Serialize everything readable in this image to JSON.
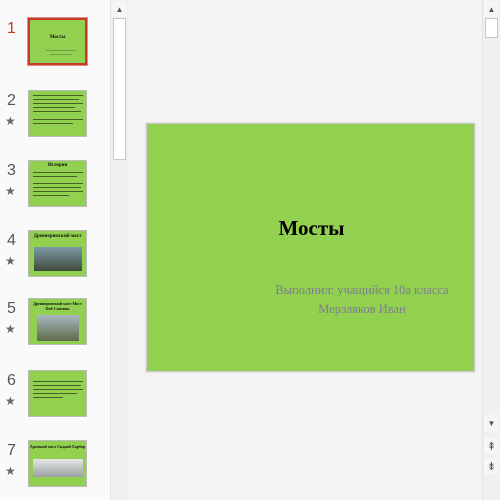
{
  "thumbnails": [
    {
      "number": "1",
      "title": "Мосты",
      "active": true
    },
    {
      "number": "2",
      "star_icon": "star-icon"
    },
    {
      "number": "3",
      "title": "История",
      "star_icon": "star-icon"
    },
    {
      "number": "4",
      "title": "Древнеримский мост",
      "star_icon": "star-icon"
    },
    {
      "number": "5",
      "title": "Древнеримский мост Мост Фаб Сантвик",
      "star_icon": "star-icon"
    },
    {
      "number": "6",
      "star_icon": "star-icon"
    },
    {
      "number": "7",
      "title": "Арочный мост Сидней Харбор",
      "star_icon": "star-icon"
    }
  ],
  "slide": {
    "title": "Мосты",
    "subtitle_line1": "Выполнил: учащийся 10а класса",
    "subtitle_line2": "Мерзляков Иван",
    "background": "#92d050"
  },
  "icons": {
    "scroll_up": "▲",
    "scroll_down": "▼",
    "prev_slide": "⇞",
    "next_slide": "⇟"
  }
}
